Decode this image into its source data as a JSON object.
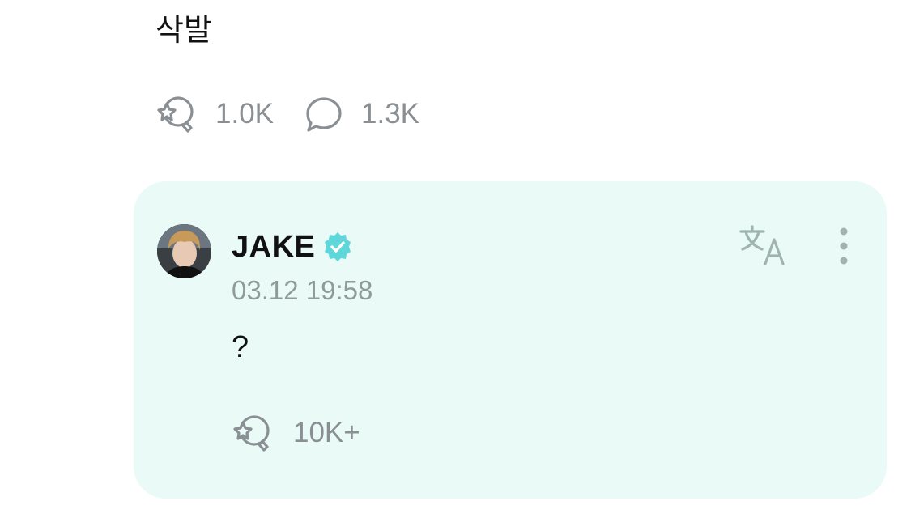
{
  "post": {
    "text": "삭발",
    "stats": {
      "cheers_count": "1.0K",
      "comments_count": "1.3K"
    }
  },
  "reply": {
    "author": "JAKE",
    "verified": true,
    "timestamp": "03.12 19:58",
    "text": "?",
    "cheers_count": "10K+"
  },
  "colors": {
    "card_background": "#e9faf7",
    "verified_badge": "#5fd6d9",
    "icon_gray": "#8a8f93",
    "translate_icon": "#9fb3b1"
  },
  "icons": {
    "cheer": "star-balloon-icon",
    "comment": "speech-bubble-icon",
    "translate": "translate-icon",
    "more": "more-vertical-icon",
    "verified": "verified-badge-icon"
  }
}
